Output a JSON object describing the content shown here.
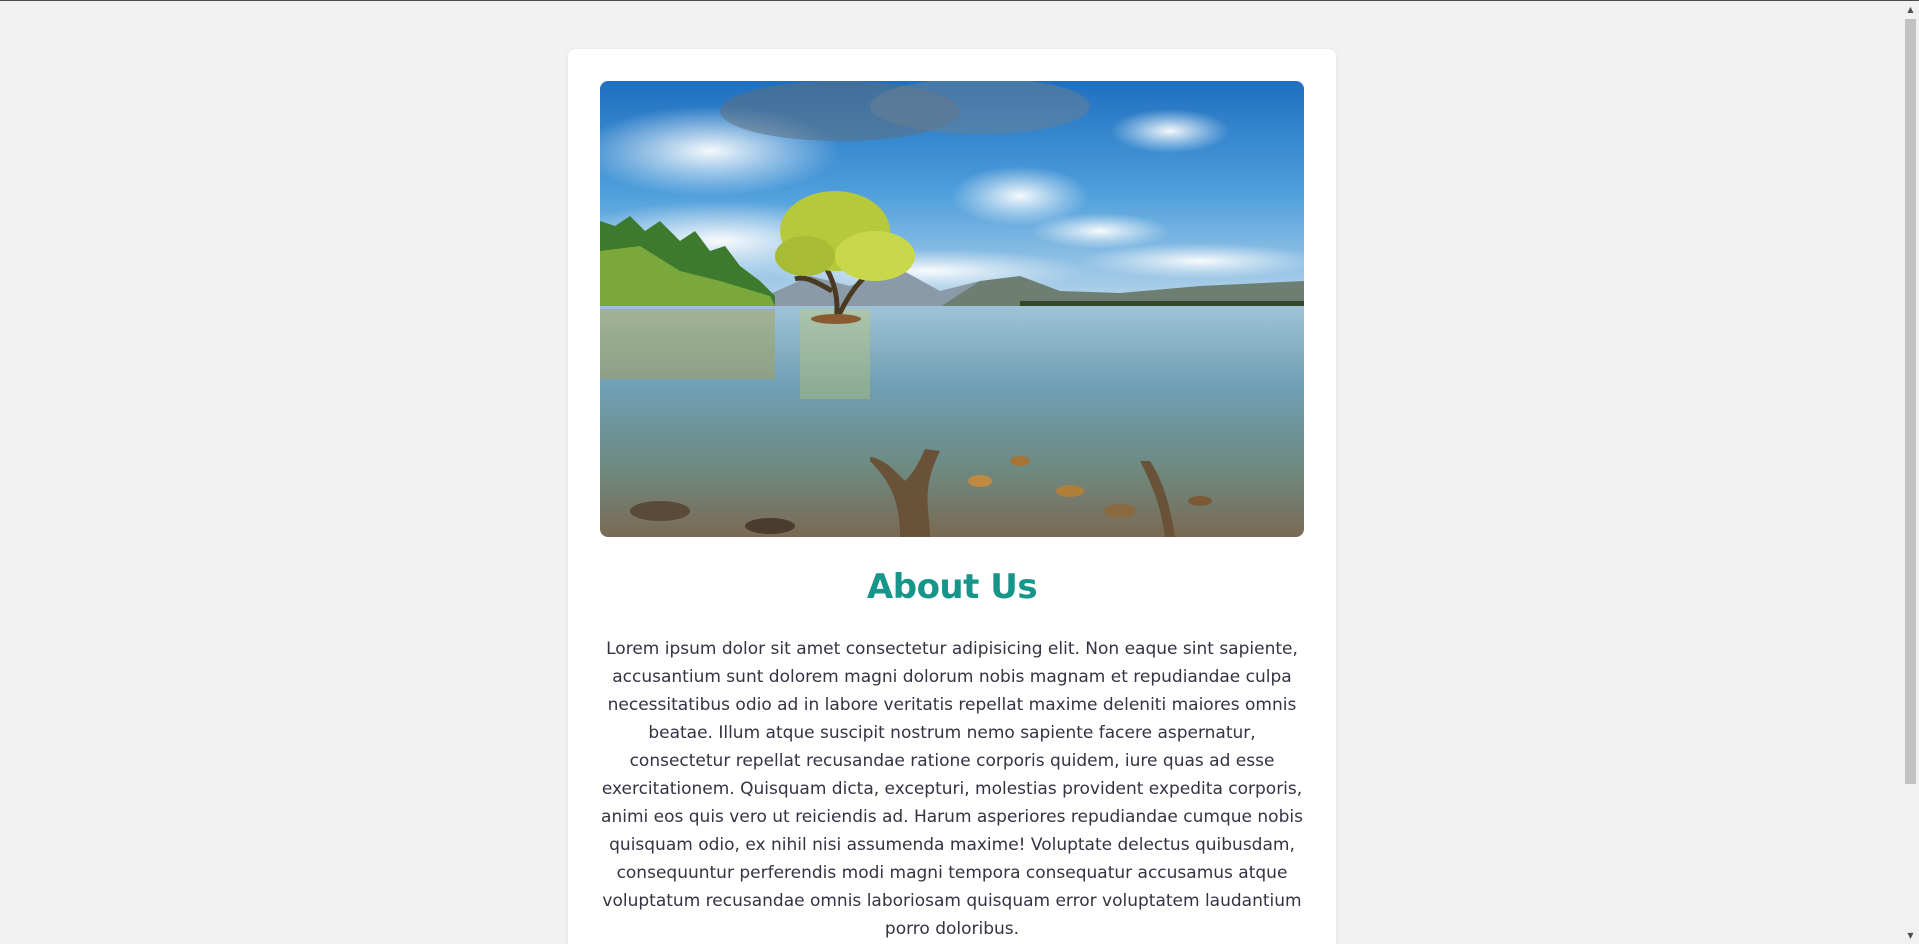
{
  "about": {
    "image_alt": "Lone tree in a lake with mountains and clouds",
    "heading": "About Us",
    "paragraph": "Lorem ipsum dolor sit amet consectetur adipisicing elit. Non eaque sint sapiente, accusantium sunt dolorem magni dolorum nobis magnam et repudiandae culpa necessitatibus odio ad in labore veritatis repellat maxime deleniti maiores omnis beatae. Illum atque suscipit nostrum nemo sapiente facere aspernatur, consectetur repellat recusandae ratione corporis quidem, iure quas ad esse exercitationem. Quisquam dicta, excepturi, molestias provident expedita corporis, animi eos quis vero ut reiciendis ad. Harum asperiores repudiandae cumque nobis quisquam odio, ex nihil nisi assumenda maxime! Voluptate delectus quibusdam, consequuntur perferendis modi magni tempora consequatur accusamus atque voluptatum recusandae omnis laboriosam quisquam error voluptatem laudantium porro doloribus."
  },
  "scrollbar": {
    "up_arrow": "▲",
    "down_arrow": "▼"
  },
  "colors": {
    "heading": "#16968a",
    "background": "#f2f2f2",
    "card": "#ffffff"
  }
}
